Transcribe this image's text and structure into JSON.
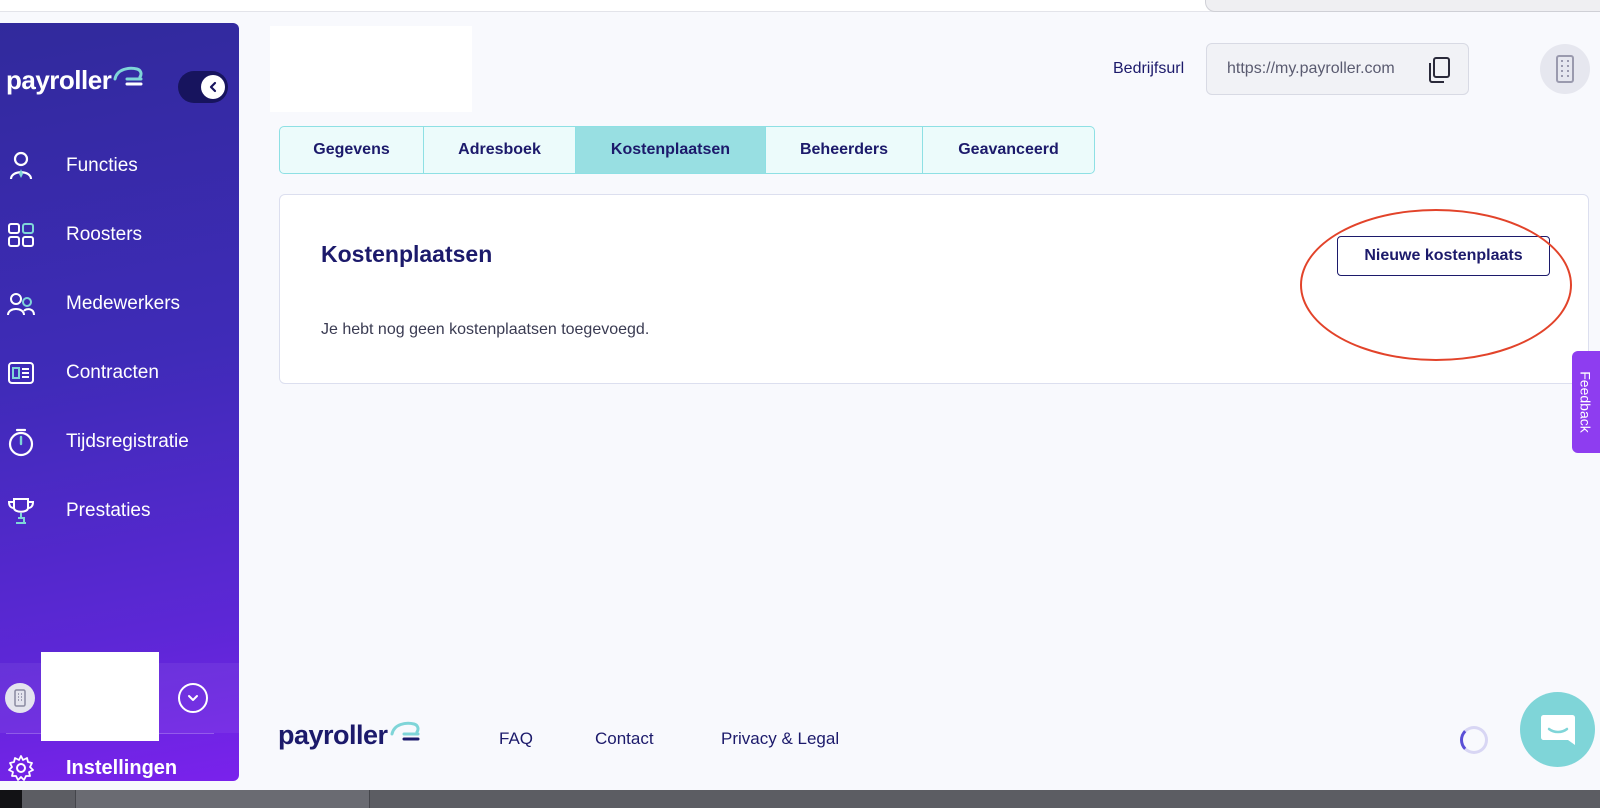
{
  "brand": {
    "name": "payroller",
    "accent": "#98dfe2",
    "primary": "#1c1a6b"
  },
  "sidebar": {
    "items": [
      {
        "label": "Functies",
        "icon": "person-tie-icon"
      },
      {
        "label": "Roosters",
        "icon": "grid-icon"
      },
      {
        "label": "Medewerkers",
        "icon": "people-icon"
      },
      {
        "label": "Contracten",
        "icon": "contract-icon"
      },
      {
        "label": "Tijdsregistratie",
        "icon": "stopwatch-icon"
      },
      {
        "label": "Prestaties",
        "icon": "trophy-icon"
      }
    ],
    "settings_label": "Instellingen"
  },
  "header": {
    "url_label": "Bedrijfsurl",
    "url_value": "https://my.payroller.com"
  },
  "tabs": [
    {
      "label": "Gegevens",
      "active": false
    },
    {
      "label": "Adresboek",
      "active": false
    },
    {
      "label": "Kostenplaatsen",
      "active": true
    },
    {
      "label": "Beheerders",
      "active": false
    },
    {
      "label": "Geavanceerd",
      "active": false
    }
  ],
  "card": {
    "title": "Kostenplaatsen",
    "new_button": "Nieuwe kostenplaats",
    "empty_text": "Je hebt nog geen kostenplaatsen toegevoegd."
  },
  "feedback_label": "Feedback",
  "footer": {
    "links": [
      "FAQ",
      "Contact",
      "Privacy & Legal"
    ]
  },
  "annotation_color": "#e2432a"
}
